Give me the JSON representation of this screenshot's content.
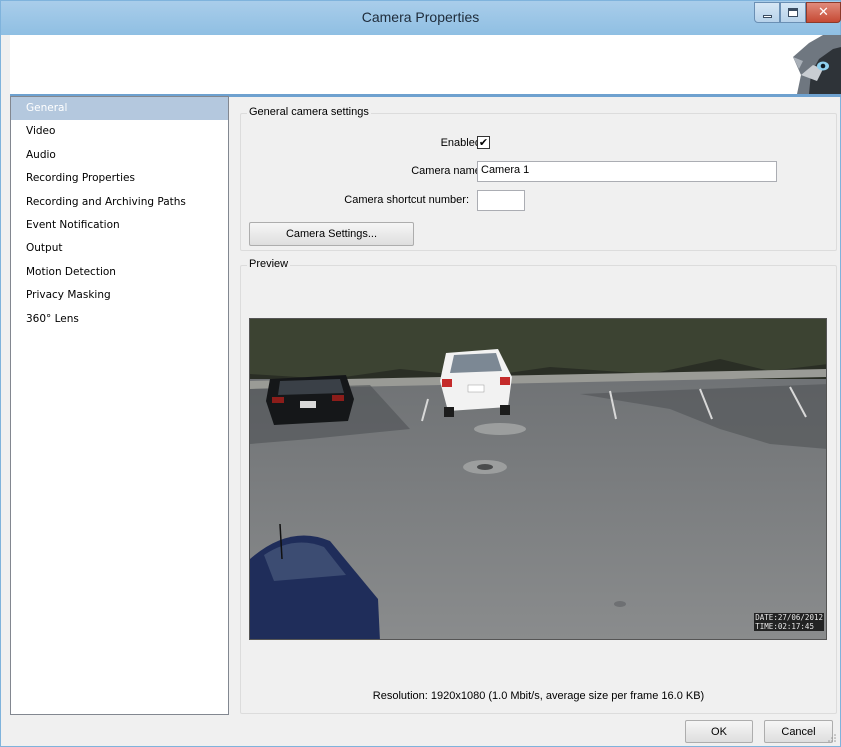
{
  "window": {
    "title": "Camera Properties"
  },
  "sidebar": {
    "items": [
      {
        "label": "General",
        "selected": true
      },
      {
        "label": "Video",
        "selected": false
      },
      {
        "label": "Audio",
        "selected": false
      },
      {
        "label": "Recording Properties",
        "selected": false
      },
      {
        "label": "Recording and Archiving Paths",
        "selected": false
      },
      {
        "label": "Event Notification",
        "selected": false
      },
      {
        "label": "Output",
        "selected": false
      },
      {
        "label": "Motion Detection",
        "selected": false
      },
      {
        "label": "Privacy Masking",
        "selected": false
      },
      {
        "label": "360° Lens",
        "selected": false
      }
    ]
  },
  "general": {
    "group_title": "General camera settings",
    "enabled_label": "Enabled:",
    "enabled_checked": true,
    "camera_name_label": "Camera name:",
    "camera_name_value": "Camera 1",
    "shortcut_label": "Camera shortcut number:",
    "shortcut_value": "",
    "settings_button": "Camera Settings..."
  },
  "preview": {
    "group_title": "Preview",
    "timestamp_date": "DATE:27/06/2012",
    "timestamp_time": "TIME:02:17:45",
    "resolution_text": "Resolution: 1920x1080  (1.0 Mbit/s, average size per frame 16.0 KB)"
  },
  "footer": {
    "ok_label": "OK",
    "cancel_label": "Cancel"
  },
  "colors": {
    "titlebar": "#a9cdea",
    "selected_item": "#b4c8de",
    "banner_line": "#6ea1cf",
    "close_button": "#c64a34"
  }
}
